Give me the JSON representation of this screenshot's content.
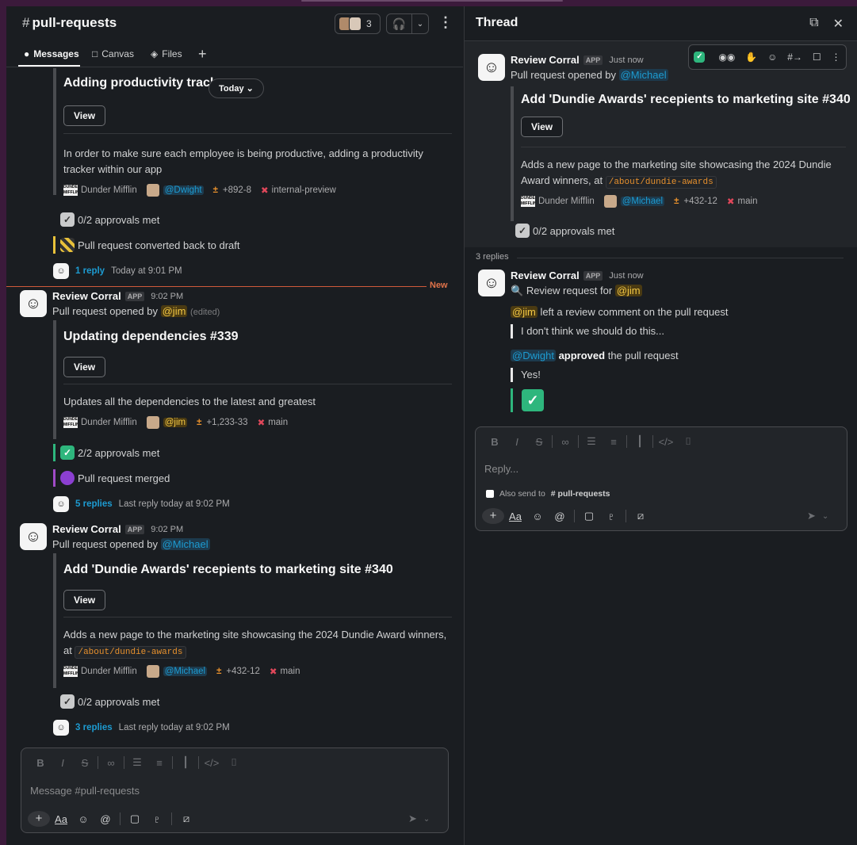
{
  "channel": {
    "name": "pull-requests",
    "member_count": "3",
    "tabs": [
      {
        "label": "Messages"
      },
      {
        "label": "Canvas"
      },
      {
        "label": "Files"
      }
    ],
    "date_pill": "Today"
  },
  "messages": [
    {
      "title": "Adding productivity track",
      "view_label": "View",
      "description": "In order to make sure each employee is being productive, adding a productivity tracker within our app",
      "org": "Dunder Mifflin",
      "author": "@Dwight",
      "diff": "+892-8",
      "branch": "internal-preview",
      "statuses": [
        "0/2 approvals met",
        "Pull request converted back to draft"
      ],
      "reply_link": "1 reply",
      "reply_meta": "Today at 9:01 PM"
    },
    {
      "bot_name": "Review Corral",
      "app_badge": "APP",
      "time": "9:02 PM",
      "opened_prefix": "Pull request opened by",
      "opened_by": "@jim",
      "edited": "(edited)",
      "title": "Updating dependencies #339",
      "view_label": "View",
      "description": "Updates all the dependencies to the latest and greatest",
      "org": "Dunder Mifflin",
      "author": "@jim",
      "diff": "+1,233-33",
      "branch": "main",
      "statuses": [
        "2/2 approvals met",
        "Pull request merged"
      ],
      "reply_link": "5 replies",
      "reply_meta": "Last reply today at 9:02 PM"
    },
    {
      "bot_name": "Review Corral",
      "app_badge": "APP",
      "time": "9:02 PM",
      "opened_prefix": "Pull request opened by",
      "opened_by": "@Michael",
      "title": "Add 'Dundie Awards' recepients to marketing site #340",
      "view_label": "View",
      "description_pre": "Adds a new page to the marketing site showcasing the 2024 Dundie Award winners, at",
      "code": "/about/dundie-awards",
      "org": "Dunder Mifflin",
      "author": "@Michael",
      "diff": "+432-12",
      "branch": "main",
      "statuses": [
        "0/2 approvals met"
      ],
      "reply_link": "3 replies",
      "reply_meta": "Last reply today at 9:02 PM"
    }
  ],
  "new_label": "New",
  "composer": {
    "placeholder": "Message #pull-requests",
    "format_label": "Aa"
  },
  "thread": {
    "title": "Thread",
    "parent": {
      "bot_name": "Review Corral",
      "app_badge": "APP",
      "time": "Just now",
      "opened_prefix": "Pull request opened by",
      "opened_by": "@Michael",
      "title": "Add 'Dundie Awards' recepients to marketing site #340",
      "view_label": "View",
      "description_pre": "Adds a new page to the marketing site showcasing the 2024 Dundie Award winners, at",
      "code": "/about/dundie-awards",
      "org": "Dunder Mifflin",
      "author": "@Michael",
      "diff": "+432-12",
      "branch": "main",
      "status": "0/2 approvals met"
    },
    "replies_count": "3 replies",
    "reply": {
      "bot_name": "Review Corral",
      "app_badge": "APP",
      "time": "Just now",
      "review_prefix": "Review request for",
      "review_target": "@jim",
      "comment_author": "@jim",
      "comment_text": "left a review comment on the pull request",
      "comment_quote": "I don't think we should do this...",
      "approver": "@Dwight",
      "approved_word": "approved",
      "approved_rest": "the pull request",
      "approve_quote": "Yes!"
    },
    "composer": {
      "placeholder": "Reply...",
      "also_send": "Also send to",
      "also_channel": "# pull-requests",
      "format_label": "Aa"
    }
  },
  "colors": {
    "background": "#1a1d21",
    "accent_link": "#1d9bd1",
    "new_line": "#d05a3a",
    "approved": "#2eb67d",
    "merged": "#a04bc7",
    "draft": "#e8c13a"
  }
}
